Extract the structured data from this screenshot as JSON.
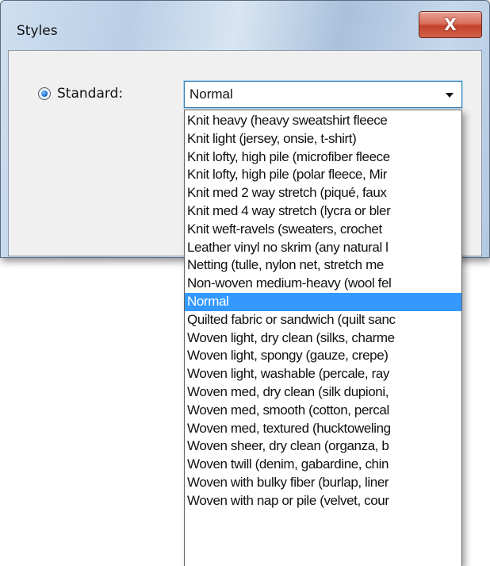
{
  "window": {
    "title": "Styles",
    "close_icon": "close-icon",
    "close_glyph": "X"
  },
  "standard_option": {
    "label": "Standard:",
    "selected": true
  },
  "style_select": {
    "value": "Normal",
    "options": [
      "Knit heavy (heavy sweatshirt fleece",
      "Knit light (jersey, onsie, t-shirt)",
      "Knit lofty, high pile (microfiber fleece",
      "Knit lofty, high pile (polar fleece, Mir",
      "Knit med 2 way stretch (piqué, faux",
      "Knit med 4 way stretch (lycra or bler",
      "Knit weft-ravels  (sweaters, crochet",
      "Leather vinyl no skrim (any natural l",
      "Netting (tulle, nylon net, stretch me",
      "Non-woven medium-heavy (wool fel",
      "Normal",
      "Quilted fabric or sandwich (quilt sanc",
      "Woven light, dry clean (silks, charme",
      "Woven light, spongy (gauze, crepe)",
      "Woven light, washable (percale, ray",
      "Woven med, dry clean (silk dupioni,",
      "Woven med, smooth (cotton, percal",
      "Woven med, textured (hucktoweling",
      "Woven sheer, dry clean (organza, b",
      "Woven twill (denim, gabardine, chin",
      "Woven with bulky fiber (burlap, liner",
      "Woven with nap or pile (velvet, cour"
    ],
    "selected_index": 10,
    "highlight_color": "#3399ff"
  }
}
